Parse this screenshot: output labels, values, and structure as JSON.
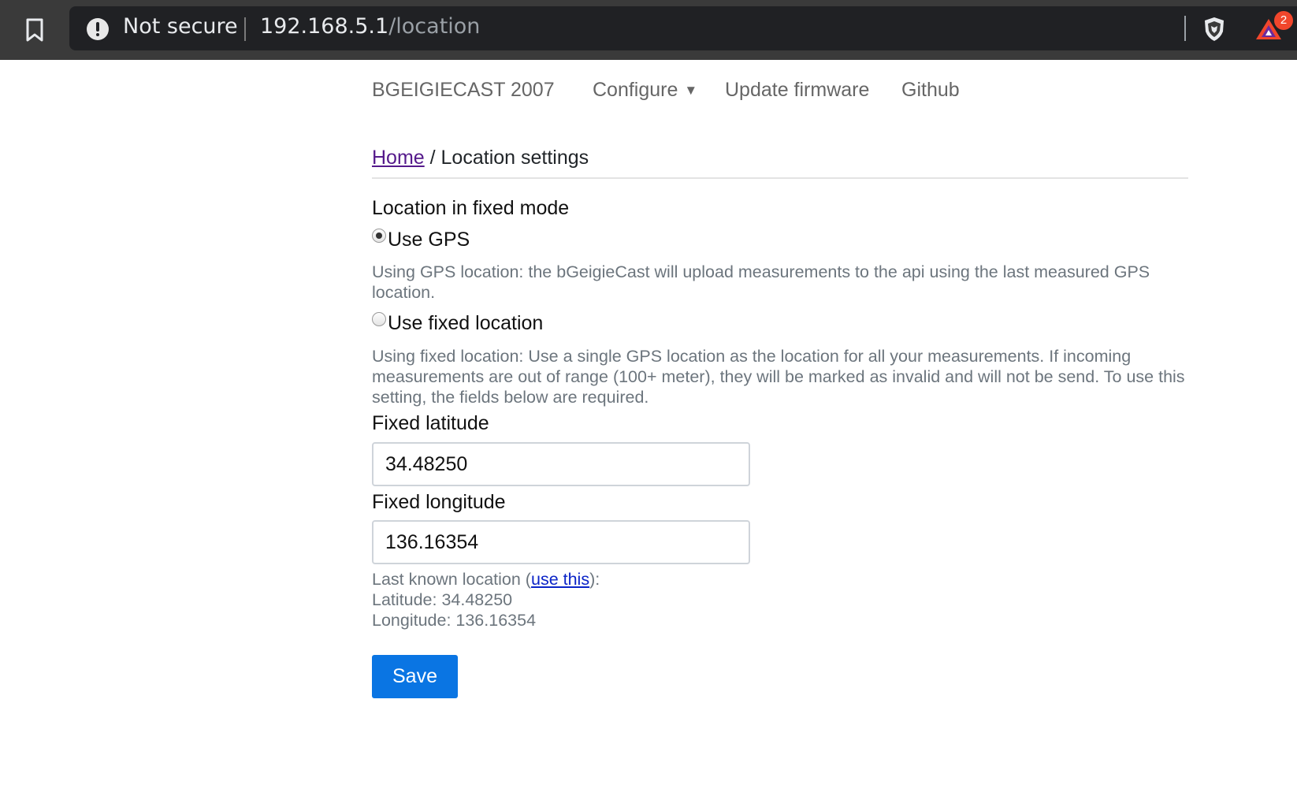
{
  "browser": {
    "security_label": "Not secure",
    "url_host": "192.168.5.1",
    "url_path": "/location",
    "rewards_badge": "2",
    "icons": [
      "bookmark-icon",
      "warning-icon",
      "brave-shields-icon",
      "brave-rewards-icon"
    ]
  },
  "nav": {
    "brand": "BGEIGIECAST 2007",
    "configure": "Configure",
    "configure_caret": "▼",
    "update_firmware": "Update firmware",
    "github": "Github"
  },
  "breadcrumb": {
    "home": "Home",
    "separator": " / ",
    "current": "Location settings"
  },
  "form": {
    "section_title": "Location in fixed mode",
    "options": [
      {
        "label": "Use GPS",
        "checked": true,
        "help": "Using GPS location: the bGeigieCast will upload measurements to the api using the last measured GPS location."
      },
      {
        "label": "Use fixed location",
        "checked": false,
        "help": "Using fixed location: Use a single GPS location as the location for all your measurements. If incoming measurements are out of range (100+ meter), they will be marked as invalid and will not be send. To use this setting, the fields below are required."
      }
    ],
    "latitude_label": "Fixed latitude",
    "latitude_value": "34.48250",
    "longitude_label": "Fixed longitude",
    "longitude_value": "136.16354",
    "last_known_prefix": "Last known location (",
    "use_this": "use this",
    "last_known_suffix": "):",
    "last_latitude": "Latitude: 34.48250",
    "last_longitude": "Longitude: 136.16354",
    "save": "Save"
  },
  "colors": {
    "chrome_bg": "#3a3a3a",
    "urlbar_bg": "#202124",
    "save_button": "#0a75e3",
    "link": "#0b24c7",
    "visited_link": "#551a8b"
  }
}
